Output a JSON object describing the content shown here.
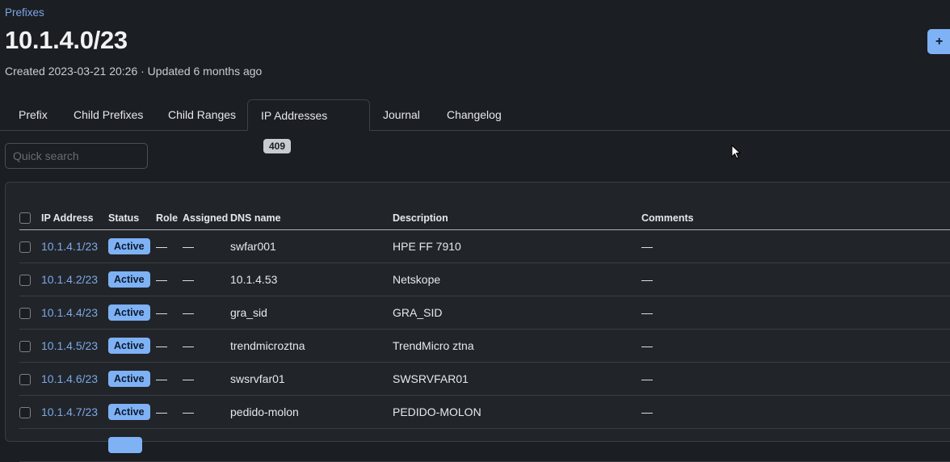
{
  "breadcrumb": "Prefixes",
  "title": "10.1.4.0/23",
  "meta": "Created 2023-03-21 20:26 · Updated 6 months ago",
  "add_button": "+",
  "tabs": [
    {
      "label": "Prefix"
    },
    {
      "label": "Child Prefixes"
    },
    {
      "label": "Child Ranges"
    },
    {
      "label": "IP Addresses",
      "badge": "409"
    },
    {
      "label": "Journal"
    },
    {
      "label": "Changelog"
    }
  ],
  "search": {
    "placeholder": "Quick search"
  },
  "table": {
    "headers": [
      "IP Address",
      "Status",
      "Role",
      "Assigned",
      "DNS name",
      "Description",
      "Comments"
    ],
    "rows": [
      {
        "ip": "10.1.4.1/23",
        "status": "Active",
        "role": "—",
        "assigned": "—",
        "dns": "swfar001",
        "description": "HPE FF 7910",
        "comments": "—"
      },
      {
        "ip": "10.1.4.2/23",
        "status": "Active",
        "role": "—",
        "assigned": "—",
        "dns": "10.1.4.53",
        "description": "Netskope",
        "comments": "—"
      },
      {
        "ip": "10.1.4.4/23",
        "status": "Active",
        "role": "—",
        "assigned": "—",
        "dns": "gra_sid",
        "description": "GRA_SID",
        "comments": "—"
      },
      {
        "ip": "10.1.4.5/23",
        "status": "Active",
        "role": "—",
        "assigned": "—",
        "dns": "trendmicroztna",
        "description": "TrendMicro ztna",
        "comments": "—"
      },
      {
        "ip": "10.1.4.6/23",
        "status": "Active",
        "role": "—",
        "assigned": "—",
        "dns": "swsrvfar01",
        "description": "SWSRVFAR01",
        "comments": "—"
      },
      {
        "ip": "10.1.4.7/23",
        "status": "Active",
        "role": "—",
        "assigned": "—",
        "dns": "pedido-molon",
        "description": "PEDIDO-MOLON",
        "comments": "—"
      }
    ]
  },
  "colors": {
    "accent": "#7fb1f5",
    "link": "#7da7e8",
    "background": "#1b1e22"
  }
}
